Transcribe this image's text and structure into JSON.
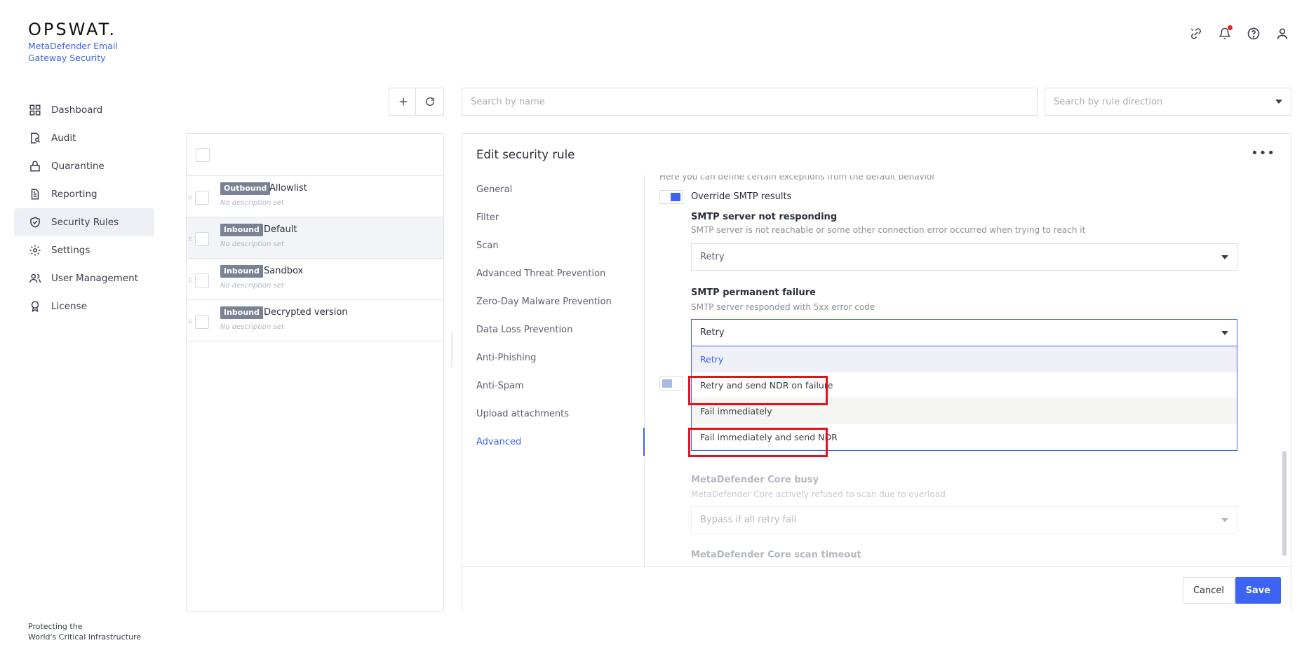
{
  "brand": {
    "logo": "OPSWAT.",
    "product": "MetaDefender Email Gateway Security",
    "tagline_line1": "Protecting the",
    "tagline_line2": "World's Critical Infrastructure"
  },
  "colors": {
    "accent": "#3d63f5",
    "tag": "#7b8294",
    "highlight": "#e0121c",
    "notification": "#e8202a"
  },
  "topbar_icons": [
    "link-icon",
    "bell-icon",
    "help-icon",
    "user-icon"
  ],
  "sidebar": {
    "items": [
      {
        "label": "Dashboard",
        "icon": "dashboard-icon"
      },
      {
        "label": "Audit",
        "icon": "audit-icon"
      },
      {
        "label": "Quarantine",
        "icon": "lock-icon"
      },
      {
        "label": "Reporting",
        "icon": "document-icon"
      },
      {
        "label": "Security Rules",
        "icon": "shield-check-icon",
        "active": true
      },
      {
        "label": "Settings",
        "icon": "gear-icon"
      },
      {
        "label": "User Management",
        "icon": "users-icon"
      },
      {
        "label": "License",
        "icon": "badge-icon"
      }
    ]
  },
  "toolbar": {
    "add_icon": "plus-icon",
    "refresh_icon": "refresh-icon"
  },
  "search": {
    "name_placeholder": "Search by name",
    "direction_placeholder": "Search by rule direction"
  },
  "rules": [
    {
      "direction": "Outbound",
      "name": "Allowlist",
      "description": "No description set"
    },
    {
      "direction": "Inbound",
      "name": "Default",
      "description": "No description set",
      "selected": true
    },
    {
      "direction": "Inbound",
      "name": "Sandbox",
      "description": "No description set"
    },
    {
      "direction": "Inbound",
      "name": "Decrypted version",
      "description": "No description set"
    }
  ],
  "editor": {
    "title": "Edit security rule",
    "more": "•••",
    "tabs": [
      "General",
      "Filter",
      "Scan",
      "Advanced Threat Prevention",
      "Zero-Day Malware Prevention",
      "Data Loss Prevention",
      "Anti-Phishing",
      "Anti-Spam",
      "Upload attachments",
      "Advanced"
    ],
    "active_tab": "Advanced",
    "intro": "Here you can define certain exceptions from the default behavior",
    "override_smtp": {
      "label": "Override SMTP results",
      "on": true
    },
    "smtp_not_responding": {
      "title": "SMTP server not responding",
      "description": "SMTP server is not reachable or some other connection error occurred when trying to reach it",
      "value": "Retry"
    },
    "smtp_permanent_failure": {
      "title": "SMTP permanent failure",
      "description": "SMTP server responded with 5xx error code",
      "value": "Retry",
      "options": [
        "Retry",
        "Retry and send NDR on failure",
        "Fail immediately",
        "Fail immediately and send NDR"
      ]
    },
    "second_toggle": {
      "on": false
    },
    "core_busy": {
      "title": "MetaDefender Core busy",
      "description": "MetaDefender Core actively refused to scan due to overload",
      "value": "Bypass if all retry fail"
    },
    "core_timeout": {
      "title": "MetaDefender Core scan timeout"
    },
    "cancel_label": "Cancel",
    "save_label": "Save"
  }
}
